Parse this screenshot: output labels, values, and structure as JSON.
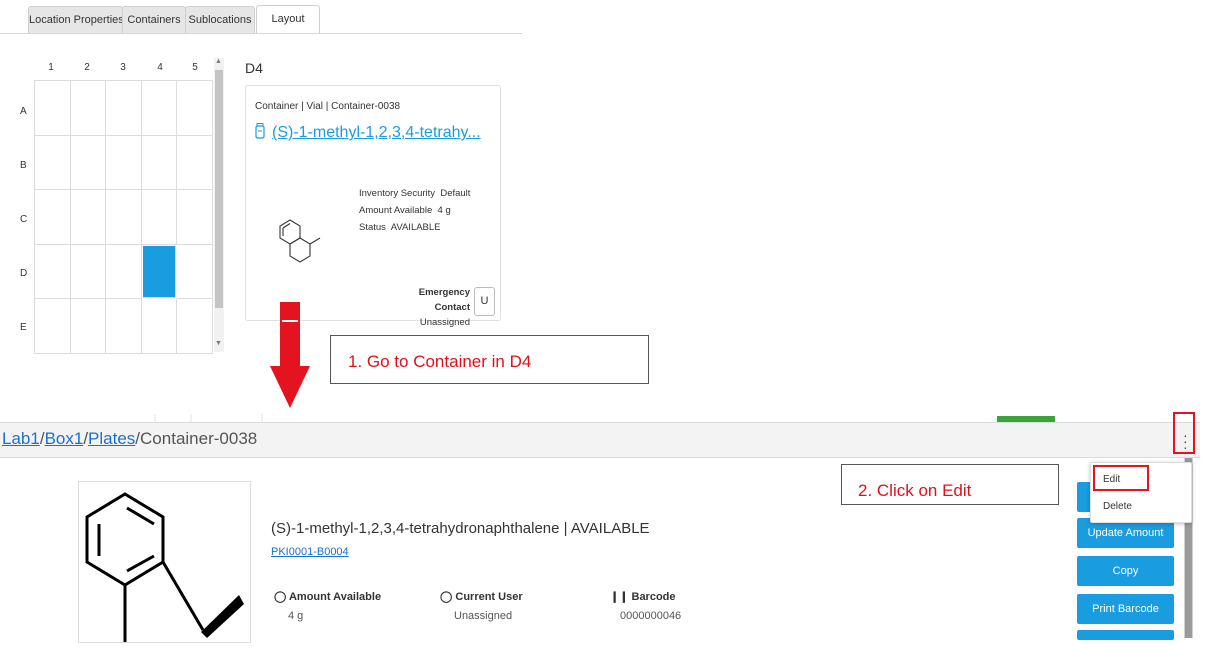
{
  "tabs": [
    {
      "label": "Location Properties",
      "active": false
    },
    {
      "label": "Containers",
      "active": false
    },
    {
      "label": "Sublocations",
      "active": false
    },
    {
      "label": "Layout",
      "active": true
    }
  ],
  "grid": {
    "columns": [
      "1",
      "2",
      "3",
      "4",
      "5"
    ],
    "rows": [
      "A",
      "B",
      "C",
      "D",
      "E"
    ],
    "selected_cell": "D4",
    "selected_color": "#1a9de0"
  },
  "card": {
    "position_label": "D4",
    "crumb": "Container | Vial | Container-0038",
    "name": "(S)-1-methyl-1,2,3,4-tetrahy...",
    "inventory_security_label": "Inventory Security",
    "inventory_security_value": "Default",
    "amount_label": "Amount Available",
    "amount_value": "4 g",
    "status_label": "Status",
    "status_value": "AVAILABLE",
    "emergency_label": "Emergency Contact",
    "emergency_value": "Unassigned",
    "emergency_button": "U"
  },
  "callouts": {
    "step1": "1. Go to Container in D4",
    "step2": "2. Click on Edit",
    "color": "#e0101b"
  },
  "detail": {
    "breadcrumb": [
      {
        "label": "Lab1",
        "link": true
      },
      {
        "label": "Box1",
        "link": true
      },
      {
        "label": "Plates",
        "link": true
      },
      {
        "label": "Container-0038",
        "link": false
      }
    ],
    "separator": "/",
    "title": "(S)-1-methyl-1,2,3,4-tetrahydronaphthalene | AVAILABLE",
    "subtitle": "PKI0001-B0004",
    "attributes": [
      {
        "icon": "clock-icon",
        "label": "Amount Available",
        "value": "4 g"
      },
      {
        "icon": "user-icon",
        "label": "Current User",
        "value": "Unassigned"
      },
      {
        "icon": "barcode-icon",
        "label": "Barcode",
        "value": "0000000046"
      }
    ],
    "actions": [
      "Update Amount",
      "Copy",
      "Print Barcode"
    ],
    "menu": [
      "Edit",
      "Delete"
    ],
    "accent": "#1a9de0"
  }
}
